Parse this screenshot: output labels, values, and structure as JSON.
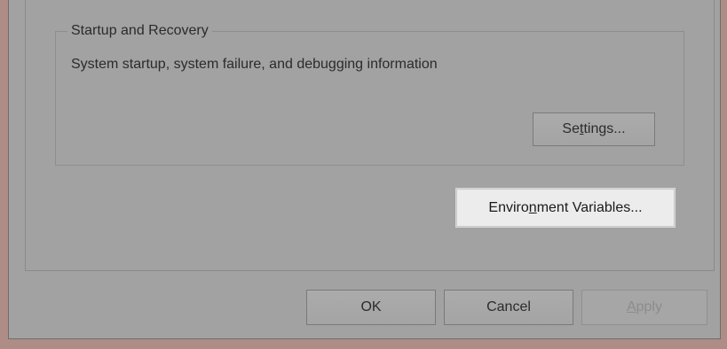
{
  "group": {
    "title": "Startup and Recovery",
    "description": "System startup, system failure, and debugging information",
    "settings_button": {
      "pre": "Se",
      "key": "t",
      "post": "tings..."
    }
  },
  "env_button": {
    "pre": "Enviro",
    "key": "n",
    "post": "ment Variables..."
  },
  "footer": {
    "ok_label": "OK",
    "cancel_label": "Cancel",
    "apply": {
      "key": "A",
      "post": "pply"
    }
  }
}
